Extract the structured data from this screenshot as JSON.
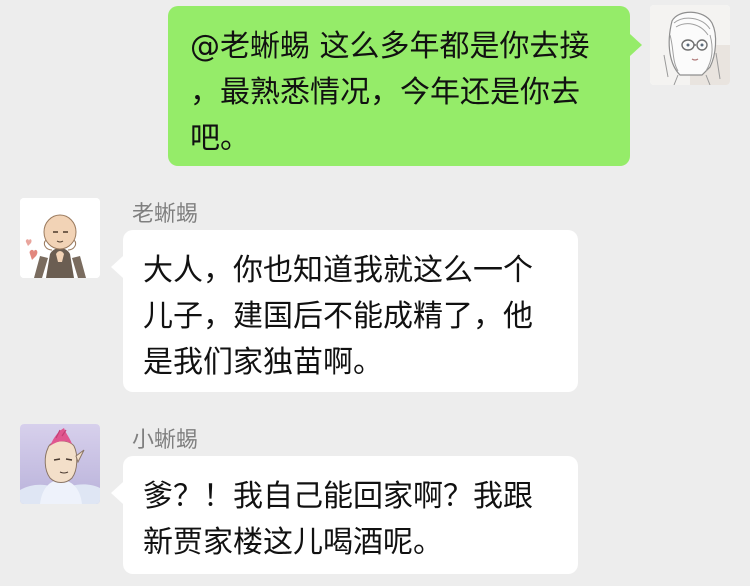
{
  "messages": [
    {
      "side": "right",
      "sender": "",
      "avatar_icon": "girl-sketch-avatar-icon",
      "lines": [
        "@老蜥蜴 这么多年都是你去接",
        "，最熟悉情况，今年还是你去",
        "吧。"
      ]
    },
    {
      "side": "left",
      "sender": "老蜥蜴",
      "avatar_icon": "bald-old-man-avatar-icon",
      "lines": [
        "大人，你也知道我就这么一个",
        "儿子，建国后不能成精了，他",
        "是我们家独苗啊。"
      ]
    },
    {
      "side": "left",
      "sender": "小蜥蜴",
      "avatar_icon": "pink-mohawk-lizard-avatar-icon",
      "lines": [
        "爹？！我自己能回家啊？我跟",
        "新贾家楼这儿喝酒呢。"
      ]
    }
  ],
  "colors": {
    "background": "#ededed",
    "self_bubble": "#95ec69",
    "other_bubble": "#ffffff",
    "sender_name": "#7f7f7f"
  }
}
